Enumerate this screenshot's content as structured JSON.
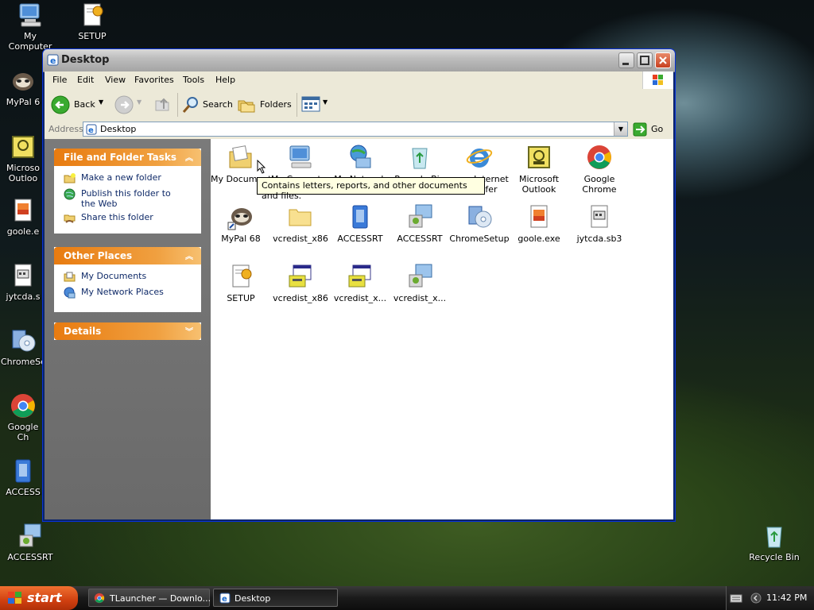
{
  "desktop": {
    "icons": [
      {
        "label": "My Computer"
      },
      {
        "label": "SETUP"
      },
      {
        "label": "MyPal 6"
      },
      {
        "label": "Microso Outloo"
      },
      {
        "label": "goole.e"
      },
      {
        "label": "jytcda.s"
      },
      {
        "label": "ChromeSe"
      },
      {
        "label": "Google Ch"
      },
      {
        "label": "ACCESS"
      },
      {
        "label": "ACCESSRT"
      },
      {
        "label": "Recycle Bin"
      }
    ]
  },
  "window": {
    "title": "Desktop",
    "menu": [
      "File",
      "Edit",
      "View",
      "Favorites",
      "Tools",
      "Help"
    ],
    "toolbar": {
      "back": "Back",
      "search": "Search",
      "folders": "Folders"
    },
    "address": {
      "label": "Address",
      "value": "Desktop",
      "go": "Go"
    },
    "panels": {
      "file_tasks": {
        "title": "File and Folder Tasks",
        "items": [
          "Make a new folder",
          "Publish this folder to the Web",
          "Share this folder"
        ]
      },
      "other_places": {
        "title": "Other Places",
        "items": [
          "My Documents",
          "My Network Places"
        ]
      },
      "details": {
        "title": "Details"
      }
    },
    "files": [
      {
        "label": "My Documents"
      },
      {
        "label": "My Computer"
      },
      {
        "label": "My Network"
      },
      {
        "label": "Recycle Bin"
      },
      {
        "label": "Internet fer"
      },
      {
        "label": "Microsoft Outlook"
      },
      {
        "label": "Google Chrome"
      },
      {
        "label": "MyPal 68"
      },
      {
        "label": "vcredist_x86"
      },
      {
        "label": "ACCESSRT"
      },
      {
        "label": "ACCESSRT"
      },
      {
        "label": "ChromeSetup"
      },
      {
        "label": "goole.exe"
      },
      {
        "label": "jytcda.sb3"
      },
      {
        "label": "SETUP"
      },
      {
        "label": "vcredist_x86"
      },
      {
        "label": "vcredist_x..."
      },
      {
        "label": "vcredist_x..."
      }
    ],
    "tooltip": "Contains letters, reports, and other documents and files."
  },
  "taskbar": {
    "start": "start",
    "tasks": [
      "TLauncher — Downlo...",
      "Desktop"
    ],
    "clock": "11:42 PM"
  },
  "colors": {
    "panel_header": "#e87b10",
    "link": "#0f2a68",
    "tooltip_bg": "#ffffe1"
  }
}
